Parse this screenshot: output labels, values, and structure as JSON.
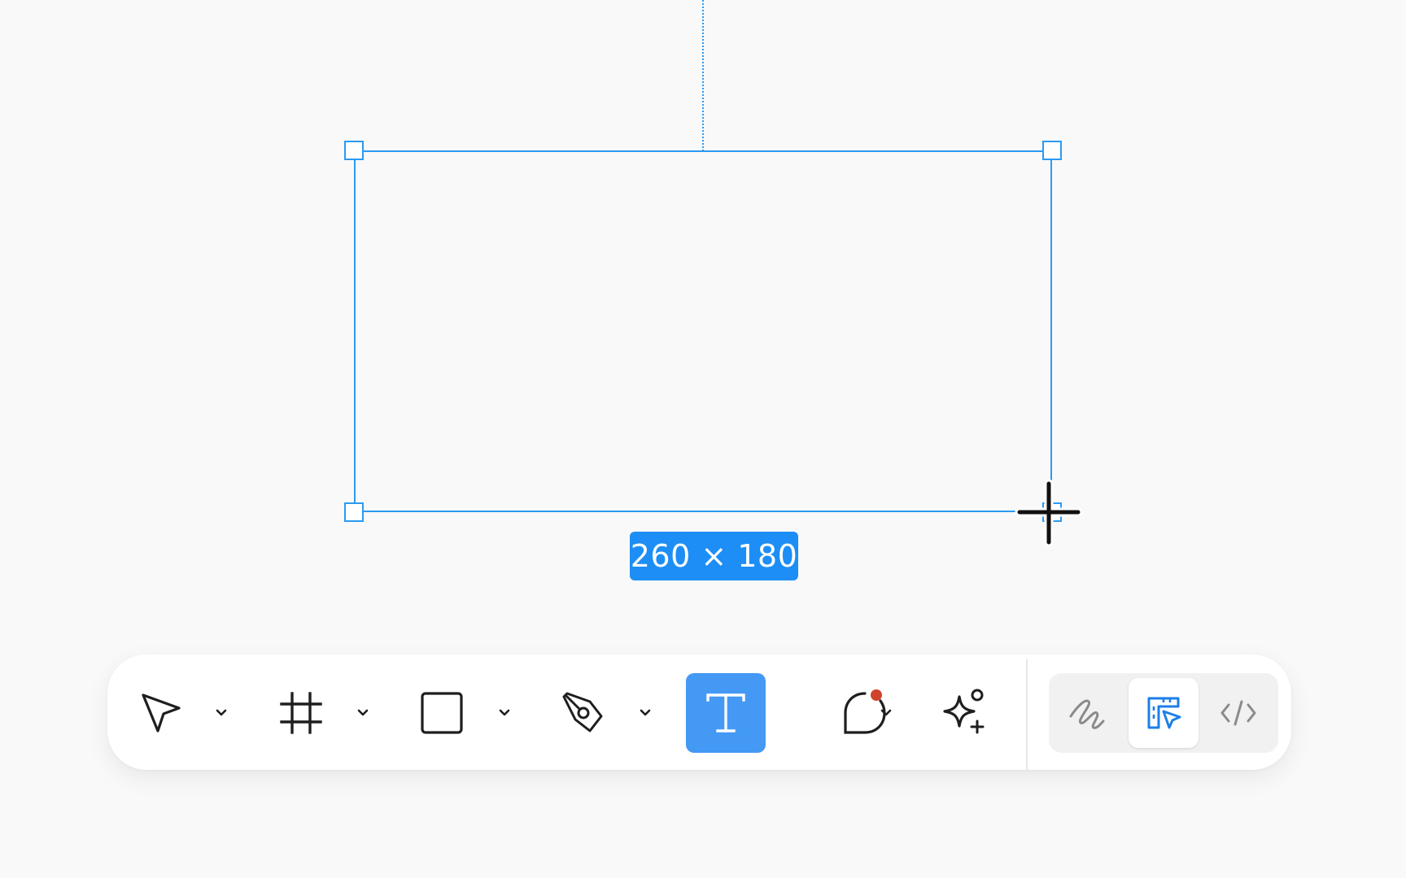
{
  "canvas": {
    "selection": {
      "size_label": "260 × 180",
      "color": "#2b9af3"
    }
  },
  "toolbar": {
    "tools": [
      {
        "name": "move",
        "icon": "cursor-arrow-icon",
        "has_menu": true,
        "active": false
      },
      {
        "name": "frame",
        "icon": "frame-hash-icon",
        "has_menu": true,
        "active": false
      },
      {
        "name": "shape",
        "icon": "rectangle-icon",
        "has_menu": true,
        "active": false
      },
      {
        "name": "pen",
        "icon": "pen-nib-icon",
        "has_menu": true,
        "active": false
      },
      {
        "name": "text",
        "icon": "text-t-icon",
        "has_menu": false,
        "active": true
      },
      {
        "name": "comment",
        "icon": "comment-bubble-icon",
        "has_menu": true,
        "active": false,
        "has_notification": true
      },
      {
        "name": "actions",
        "icon": "ai-sparkle-icon",
        "has_menu": false,
        "active": false
      }
    ],
    "modes": [
      {
        "name": "draw",
        "icon": "squiggle-icon",
        "active": false
      },
      {
        "name": "design",
        "icon": "design-ruler-cursor-icon",
        "active": true
      },
      {
        "name": "dev",
        "icon": "code-brackets-icon",
        "active": false
      }
    ],
    "accent_color": "#4499f5",
    "notification_color": "#d0442b"
  }
}
